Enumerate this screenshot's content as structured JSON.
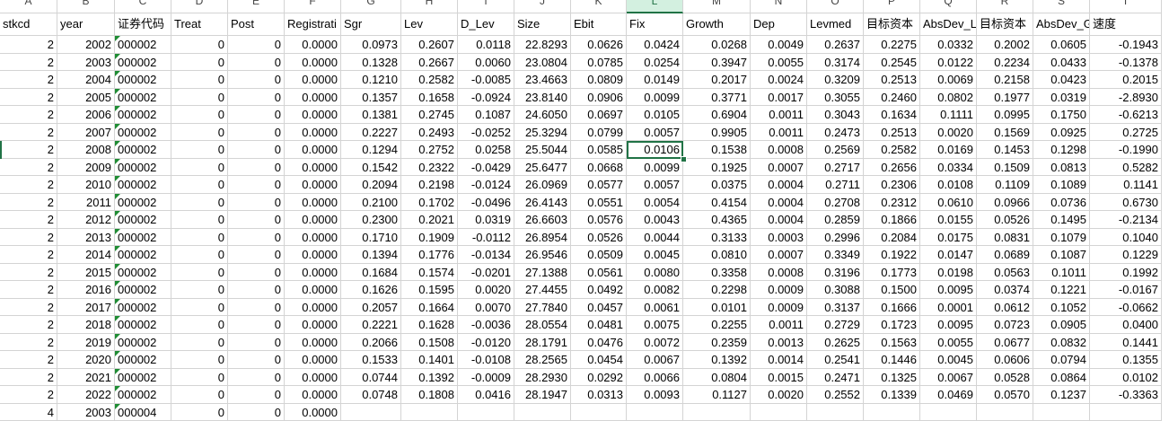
{
  "columns": [
    "A",
    "B",
    "C",
    "D",
    "E",
    "F",
    "G",
    "H",
    "I",
    "J",
    "K",
    "L",
    "M",
    "N",
    "O",
    "P",
    "Q",
    "R",
    "S",
    "T"
  ],
  "headers": [
    "stkcd",
    "year",
    "证券代码",
    "Treat",
    "Post",
    "Registrati",
    "Sgr",
    "Lev",
    "D_Lev",
    "Size",
    "Ebit",
    "Fix",
    "Growth",
    "Dep",
    "Levmed",
    "目标资本",
    "AbsDev_L",
    "目标资本",
    "AbsDev_G",
    "速度"
  ],
  "selected_cell": {
    "column": "L",
    "row_index": 6,
    "value": "0.0106"
  },
  "accent_color": "#217346",
  "rows": [
    [
      "2",
      "2002",
      "000002",
      "0",
      "0",
      "0.0000",
      "0.0973",
      "0.2607",
      "0.0118",
      "22.8293",
      "0.0626",
      "0.0424",
      "0.0268",
      "0.0049",
      "0.2637",
      "0.2275",
      "0.0332",
      "0.2002",
      "0.0605",
      "-0.1943"
    ],
    [
      "2",
      "2003",
      "000002",
      "0",
      "0",
      "0.0000",
      "0.1328",
      "0.2667",
      "0.0060",
      "23.0804",
      "0.0785",
      "0.0254",
      "0.3947",
      "0.0055",
      "0.3174",
      "0.2545",
      "0.0122",
      "0.2234",
      "0.0433",
      "-0.1378"
    ],
    [
      "2",
      "2004",
      "000002",
      "0",
      "0",
      "0.0000",
      "0.1210",
      "0.2582",
      "-0.0085",
      "23.4663",
      "0.0809",
      "0.0149",
      "0.2017",
      "0.0024",
      "0.3209",
      "0.2513",
      "0.0069",
      "0.2158",
      "0.0423",
      "0.2015"
    ],
    [
      "2",
      "2005",
      "000002",
      "0",
      "0",
      "0.0000",
      "0.1357",
      "0.1658",
      "-0.0924",
      "23.8140",
      "0.0906",
      "0.0099",
      "0.3771",
      "0.0017",
      "0.3055",
      "0.2460",
      "0.0802",
      "0.1977",
      "0.0319",
      "-2.8930"
    ],
    [
      "2",
      "2006",
      "000002",
      "0",
      "0",
      "0.0000",
      "0.1381",
      "0.2745",
      "0.1087",
      "24.6050",
      "0.0697",
      "0.0105",
      "0.6904",
      "0.0011",
      "0.3043",
      "0.1634",
      "0.1111",
      "0.0995",
      "0.1750",
      "-0.6213"
    ],
    [
      "2",
      "2007",
      "000002",
      "0",
      "0",
      "0.0000",
      "0.2227",
      "0.2493",
      "-0.0252",
      "25.3294",
      "0.0799",
      "0.0057",
      "0.9905",
      "0.0011",
      "0.2473",
      "0.2513",
      "0.0020",
      "0.1569",
      "0.0925",
      "0.2725"
    ],
    [
      "2",
      "2008",
      "000002",
      "0",
      "0",
      "0.0000",
      "0.1294",
      "0.2752",
      "0.0258",
      "25.5044",
      "0.0585",
      "0.0106",
      "0.1538",
      "0.0008",
      "0.2569",
      "0.2582",
      "0.0169",
      "0.1453",
      "0.1298",
      "-0.1990"
    ],
    [
      "2",
      "2009",
      "000002",
      "0",
      "0",
      "0.0000",
      "0.1542",
      "0.2322",
      "-0.0429",
      "25.6477",
      "0.0668",
      "0.0099",
      "0.1925",
      "0.0007",
      "0.2717",
      "0.2656",
      "0.0334",
      "0.1509",
      "0.0813",
      "0.5282"
    ],
    [
      "2",
      "2010",
      "000002",
      "0",
      "0",
      "0.0000",
      "0.2094",
      "0.2198",
      "-0.0124",
      "26.0969",
      "0.0577",
      "0.0057",
      "0.0375",
      "0.0004",
      "0.2711",
      "0.2306",
      "0.0108",
      "0.1109",
      "0.1089",
      "0.1141"
    ],
    [
      "2",
      "2011",
      "000002",
      "0",
      "0",
      "0.0000",
      "0.2100",
      "0.1702",
      "-0.0496",
      "26.4143",
      "0.0551",
      "0.0054",
      "0.4154",
      "0.0004",
      "0.2708",
      "0.2312",
      "0.0610",
      "0.0966",
      "0.0736",
      "0.6730"
    ],
    [
      "2",
      "2012",
      "000002",
      "0",
      "0",
      "0.0000",
      "0.2300",
      "0.2021",
      "0.0319",
      "26.6603",
      "0.0576",
      "0.0043",
      "0.4365",
      "0.0004",
      "0.2859",
      "0.1866",
      "0.0155",
      "0.0526",
      "0.1495",
      "-0.2134"
    ],
    [
      "2",
      "2013",
      "000002",
      "0",
      "0",
      "0.0000",
      "0.1710",
      "0.1909",
      "-0.0112",
      "26.8954",
      "0.0526",
      "0.0044",
      "0.3133",
      "0.0003",
      "0.2996",
      "0.2084",
      "0.0175",
      "0.0831",
      "0.1079",
      "0.1040"
    ],
    [
      "2",
      "2014",
      "000002",
      "0",
      "0",
      "0.0000",
      "0.1394",
      "0.1776",
      "-0.0134",
      "26.9546",
      "0.0509",
      "0.0045",
      "0.0810",
      "0.0007",
      "0.3349",
      "0.1922",
      "0.0147",
      "0.0689",
      "0.1087",
      "0.1229"
    ],
    [
      "2",
      "2015",
      "000002",
      "0",
      "0",
      "0.0000",
      "0.1684",
      "0.1574",
      "-0.0201",
      "27.1388",
      "0.0561",
      "0.0080",
      "0.3358",
      "0.0008",
      "0.3196",
      "0.1773",
      "0.0198",
      "0.0563",
      "0.1011",
      "0.1992"
    ],
    [
      "2",
      "2016",
      "000002",
      "0",
      "0",
      "0.0000",
      "0.1626",
      "0.1595",
      "0.0020",
      "27.4455",
      "0.0492",
      "0.0082",
      "0.2298",
      "0.0009",
      "0.3088",
      "0.1500",
      "0.0095",
      "0.0374",
      "0.1221",
      "-0.0167"
    ],
    [
      "2",
      "2017",
      "000002",
      "0",
      "0",
      "0.0000",
      "0.2057",
      "0.1664",
      "0.0070",
      "27.7840",
      "0.0457",
      "0.0061",
      "0.0101",
      "0.0009",
      "0.3137",
      "0.1666",
      "0.0001",
      "0.0612",
      "0.1052",
      "-0.0662"
    ],
    [
      "2",
      "2018",
      "000002",
      "0",
      "0",
      "0.0000",
      "0.2221",
      "0.1628",
      "-0.0036",
      "28.0554",
      "0.0481",
      "0.0075",
      "0.2255",
      "0.0011",
      "0.2729",
      "0.1723",
      "0.0095",
      "0.0723",
      "0.0905",
      "0.0400"
    ],
    [
      "2",
      "2019",
      "000002",
      "0",
      "0",
      "0.0000",
      "0.2066",
      "0.1508",
      "-0.0120",
      "28.1791",
      "0.0476",
      "0.0072",
      "0.2359",
      "0.0013",
      "0.2625",
      "0.1563",
      "0.0055",
      "0.0677",
      "0.0832",
      "0.1441"
    ],
    [
      "2",
      "2020",
      "000002",
      "0",
      "0",
      "0.0000",
      "0.1533",
      "0.1401",
      "-0.0108",
      "28.2565",
      "0.0454",
      "0.0067",
      "0.1392",
      "0.0014",
      "0.2541",
      "0.1446",
      "0.0045",
      "0.0606",
      "0.0794",
      "0.1355"
    ],
    [
      "2",
      "2021",
      "000002",
      "0",
      "0",
      "0.0000",
      "0.0744",
      "0.1392",
      "-0.0009",
      "28.2930",
      "0.0292",
      "0.0066",
      "0.0804",
      "0.0015",
      "0.2471",
      "0.1325",
      "0.0067",
      "0.0528",
      "0.0864",
      "0.0102"
    ],
    [
      "2",
      "2022",
      "000002",
      "0",
      "0",
      "0.0000",
      "0.0748",
      "0.1808",
      "0.0416",
      "28.1947",
      "0.0313",
      "0.0093",
      "0.1127",
      "0.0020",
      "0.2552",
      "0.1339",
      "0.0469",
      "0.0570",
      "0.1237",
      "-0.3363"
    ],
    [
      "4",
      "2003",
      "000004",
      "0",
      "0",
      "0.0000",
      "",
      "",
      "",
      "",
      "",
      "",
      "",
      "",
      "",
      "",
      "",
      "",
      "",
      ""
    ]
  ]
}
